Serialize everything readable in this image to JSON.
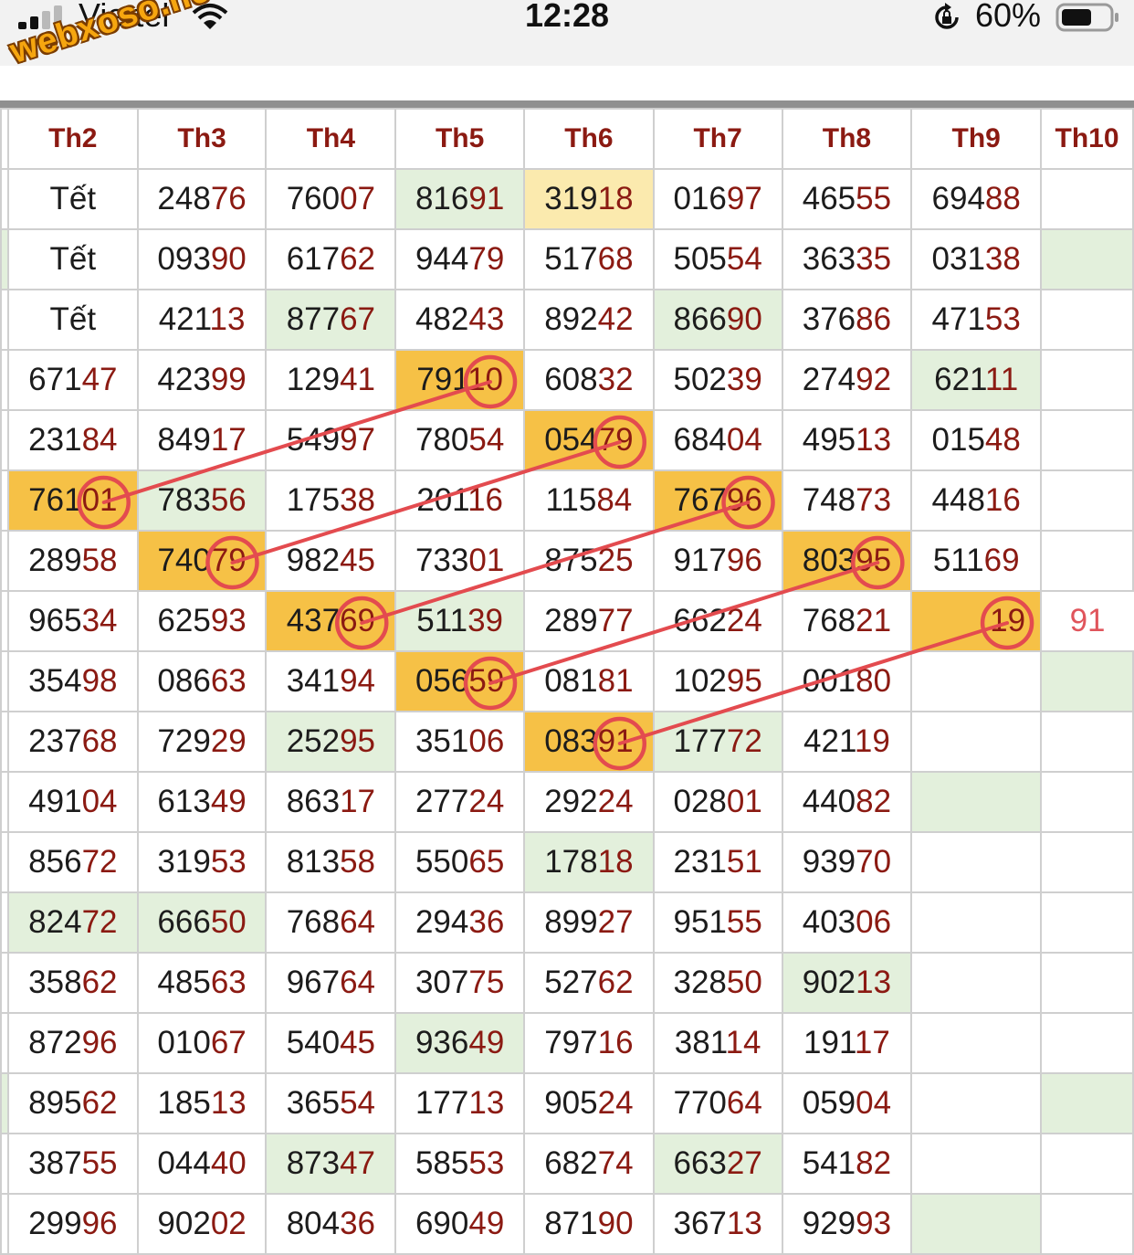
{
  "status_bar": {
    "carrier": "Viettel",
    "time": "12:28",
    "battery": "60%"
  },
  "watermark": "webxoso.net",
  "table": {
    "columns": [
      "Th2",
      "Th3",
      "Th4",
      "Th5",
      "Th6",
      "Th7",
      "Th8",
      "Th9",
      "Th10"
    ],
    "rows": [
      [
        {
          "t": "Tết"
        },
        {
          "t": "24876"
        },
        {
          "t": "76007"
        },
        {
          "t": "81691",
          "bg": "green"
        },
        {
          "t": "31918",
          "bg": "lightyellow"
        },
        {
          "t": "01697"
        },
        {
          "t": "46555"
        },
        {
          "t": "69488"
        },
        {
          "t": ""
        }
      ],
      [
        {
          "t": "Tết"
        },
        {
          "t": "09390"
        },
        {
          "t": "61762"
        },
        {
          "t": "94479"
        },
        {
          "t": "51768"
        },
        {
          "t": "50554"
        },
        {
          "t": "36335"
        },
        {
          "t": "03138"
        },
        {
          "t": "",
          "bg": "green"
        }
      ],
      [
        {
          "t": "Tết"
        },
        {
          "t": "42113"
        },
        {
          "t": "87767",
          "bg": "green"
        },
        {
          "t": "48243"
        },
        {
          "t": "89242"
        },
        {
          "t": "86690",
          "bg": "green"
        },
        {
          "t": "37686"
        },
        {
          "t": "47153"
        },
        {
          "t": ""
        }
      ],
      [
        {
          "t": "67147"
        },
        {
          "t": "42399"
        },
        {
          "t": "12941"
        },
        {
          "t": "79110",
          "bg": "orange"
        },
        {
          "t": "60832"
        },
        {
          "t": "50239"
        },
        {
          "t": "27492"
        },
        {
          "t": "62111",
          "bg": "green"
        },
        {
          "t": ""
        }
      ],
      [
        {
          "t": "23184"
        },
        {
          "t": "84917"
        },
        {
          "t": "54997"
        },
        {
          "t": "78054"
        },
        {
          "t": "05479",
          "bg": "orange"
        },
        {
          "t": "68404"
        },
        {
          "t": "49513"
        },
        {
          "t": "01548"
        },
        {
          "t": ""
        }
      ],
      [
        {
          "t": "76101",
          "bg": "orange"
        },
        {
          "t": "78356",
          "bg": "green"
        },
        {
          "t": "17538"
        },
        {
          "t": "20116"
        },
        {
          "t": "11584"
        },
        {
          "t": "76796",
          "bg": "orange"
        },
        {
          "t": "74873"
        },
        {
          "t": "44816"
        },
        {
          "t": ""
        }
      ],
      [
        {
          "t": "28958"
        },
        {
          "t": "74079",
          "bg": "orange"
        },
        {
          "t": "98245"
        },
        {
          "t": "73301"
        },
        {
          "t": "87525"
        },
        {
          "t": "91796"
        },
        {
          "t": "80395",
          "bg": "orange"
        },
        {
          "t": "51169"
        },
        {
          "t": ""
        }
      ],
      [
        {
          "t": "96534"
        },
        {
          "t": "62593"
        },
        {
          "t": "43769",
          "bg": "orange"
        },
        {
          "t": "51139",
          "bg": "green"
        },
        {
          "t": "28977"
        },
        {
          "t": "66224"
        },
        {
          "t": "76821"
        },
        {
          "t": "19",
          "bg": "orange",
          "align": "right"
        },
        {
          "t": "91",
          "extra": true
        }
      ],
      [
        {
          "t": "35498"
        },
        {
          "t": "08663"
        },
        {
          "t": "34194"
        },
        {
          "t": "05659",
          "bg": "orange"
        },
        {
          "t": "08181"
        },
        {
          "t": "10295"
        },
        {
          "t": "00180"
        },
        {
          "t": ""
        },
        {
          "t": "",
          "bg": "green"
        }
      ],
      [
        {
          "t": "23768"
        },
        {
          "t": "72929"
        },
        {
          "t": "25295",
          "bg": "green"
        },
        {
          "t": "35106"
        },
        {
          "t": "08391",
          "bg": "orange"
        },
        {
          "t": "17772",
          "bg": "green"
        },
        {
          "t": "42119"
        },
        {
          "t": ""
        },
        {
          "t": ""
        }
      ],
      [
        {
          "t": "49104"
        },
        {
          "t": "61349"
        },
        {
          "t": "86317"
        },
        {
          "t": "27724"
        },
        {
          "t": "29224"
        },
        {
          "t": "02801"
        },
        {
          "t": "44082"
        },
        {
          "t": "",
          "bg": "green"
        },
        {
          "t": ""
        }
      ],
      [
        {
          "t": "85672"
        },
        {
          "t": "31953"
        },
        {
          "t": "81358"
        },
        {
          "t": "55065"
        },
        {
          "t": "17818",
          "bg": "green"
        },
        {
          "t": "23151"
        },
        {
          "t": "93970"
        },
        {
          "t": ""
        },
        {
          "t": ""
        }
      ],
      [
        {
          "t": "82472",
          "bg": "green"
        },
        {
          "t": "66650",
          "bg": "green"
        },
        {
          "t": "76864"
        },
        {
          "t": "29436"
        },
        {
          "t": "89927"
        },
        {
          "t": "95155"
        },
        {
          "t": "40306"
        },
        {
          "t": ""
        },
        {
          "t": ""
        }
      ],
      [
        {
          "t": "35862"
        },
        {
          "t": "48563"
        },
        {
          "t": "96764"
        },
        {
          "t": "30775"
        },
        {
          "t": "52762"
        },
        {
          "t": "32850"
        },
        {
          "t": "90213",
          "bg": "green"
        },
        {
          "t": ""
        },
        {
          "t": ""
        }
      ],
      [
        {
          "t": "87296"
        },
        {
          "t": "01067"
        },
        {
          "t": "54045"
        },
        {
          "t": "93649",
          "bg": "green"
        },
        {
          "t": "79716"
        },
        {
          "t": "38114"
        },
        {
          "t": "19117"
        },
        {
          "t": ""
        },
        {
          "t": ""
        }
      ],
      [
        {
          "t": "89562"
        },
        {
          "t": "18513"
        },
        {
          "t": "36554"
        },
        {
          "t": "17713"
        },
        {
          "t": "90524"
        },
        {
          "t": "77064"
        },
        {
          "t": "05904"
        },
        {
          "t": ""
        },
        {
          "t": "",
          "bg": "green"
        }
      ],
      [
        {
          "t": "38755"
        },
        {
          "t": "04440"
        },
        {
          "t": "87347",
          "bg": "green"
        },
        {
          "t": "58553"
        },
        {
          "t": "68274"
        },
        {
          "t": "66327",
          "bg": "green"
        },
        {
          "t": "54182"
        },
        {
          "t": ""
        },
        {
          "t": ""
        }
      ],
      [
        {
          "t": "29996"
        },
        {
          "t": "90202"
        },
        {
          "t": "80436"
        },
        {
          "t": "69049"
        },
        {
          "t": "87190"
        },
        {
          "t": "36713"
        },
        {
          "t": "92993"
        },
        {
          "t": "",
          "bg": "green"
        },
        {
          "t": ""
        }
      ]
    ]
  },
  "annotations": {
    "color": "#e34b4f",
    "circles": [
      {
        "row": 3,
        "col": 3
      },
      {
        "row": 4,
        "col": 4
      },
      {
        "row": 5,
        "col": 0
      },
      {
        "row": 5,
        "col": 5
      },
      {
        "row": 6,
        "col": 1
      },
      {
        "row": 6,
        "col": 6
      },
      {
        "row": 7,
        "col": 2
      },
      {
        "row": 7,
        "col": 7
      },
      {
        "row": 8,
        "col": 3
      },
      {
        "row": 9,
        "col": 4
      }
    ],
    "lines": [
      {
        "from": {
          "row": 5,
          "col": 0
        },
        "to": {
          "row": 3,
          "col": 3
        }
      },
      {
        "from": {
          "row": 6,
          "col": 1
        },
        "to": {
          "row": 4,
          "col": 4
        }
      },
      {
        "from": {
          "row": 7,
          "col": 2
        },
        "to": {
          "row": 5,
          "col": 5
        }
      },
      {
        "from": {
          "row": 8,
          "col": 3
        },
        "to": {
          "row": 6,
          "col": 6
        }
      },
      {
        "from": {
          "row": 9,
          "col": 4
        },
        "to": {
          "row": 7,
          "col": 7
        }
      }
    ]
  }
}
